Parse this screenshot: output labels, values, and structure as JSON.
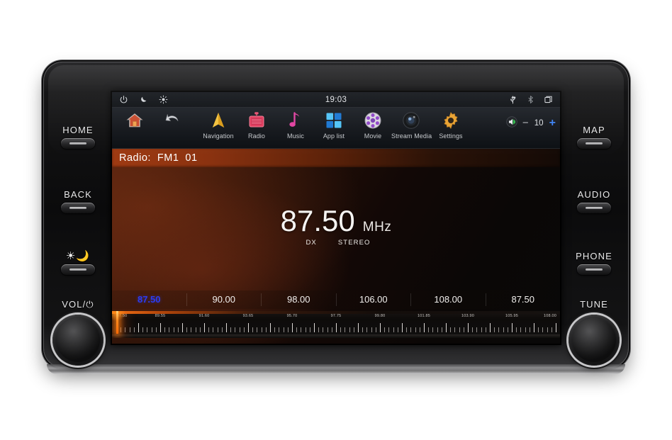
{
  "device": {
    "left_buttons": [
      {
        "label": "HOME",
        "name": "home-button"
      },
      {
        "label": "BACK",
        "name": "back-button"
      },
      {
        "label": "",
        "name": "brightness-daynight-button"
      }
    ],
    "left_knob_label": "VOL/⏻",
    "right_buttons": [
      {
        "label": "MAP",
        "name": "map-button"
      },
      {
        "label": "AUDIO",
        "name": "audio-button"
      },
      {
        "label": "PHONE",
        "name": "phone-button"
      }
    ],
    "right_knob_label": "TUNE"
  },
  "status_bar": {
    "clock": "19:03",
    "left_icons": [
      "power-icon",
      "night-mode-icon",
      "brightness-icon"
    ],
    "right_icons": [
      "usb-icon",
      "bluetooth-icon",
      "multitask-icon"
    ]
  },
  "app_bar": {
    "items": [
      {
        "label": "",
        "icon": "home-icon"
      },
      {
        "label": "",
        "icon": "back-arrow-icon"
      },
      {
        "label": "Navigation",
        "icon": "navigation-icon"
      },
      {
        "label": "Radio",
        "icon": "radio-icon"
      },
      {
        "label": "Music",
        "icon": "music-note-icon"
      },
      {
        "label": "App list",
        "icon": "app-grid-icon"
      },
      {
        "label": "Movie",
        "icon": "movie-disc-icon"
      },
      {
        "label": "Stream Media",
        "icon": "camera-lens-icon"
      },
      {
        "label": "Settings",
        "icon": "gear-icon"
      }
    ],
    "volume": {
      "icon": "speaker-icon",
      "minus": "−",
      "value": "10",
      "plus": "+"
    }
  },
  "radio": {
    "title_prefix": "Radio:",
    "band": "FM1",
    "preset_number": "01",
    "frequency": "87.50",
    "unit": "MHz",
    "tags": [
      "DX",
      "STEREO"
    ],
    "presets": [
      {
        "value": "87.50",
        "active": true
      },
      {
        "value": "90.00",
        "active": false
      },
      {
        "value": "98.00",
        "active": false
      },
      {
        "value": "106.00",
        "active": false
      },
      {
        "value": "108.00",
        "active": false
      },
      {
        "value": "87.50",
        "active": false
      }
    ],
    "tuner": {
      "min": 87.5,
      "max": 108.0,
      "current": 87.5,
      "labels": [
        "87.50",
        "89.55",
        "91.60",
        "93.65",
        "95.70",
        "97.75",
        "99.80",
        "101.85",
        "103.90",
        "105.95",
        "108.00"
      ]
    }
  },
  "toolbar": {
    "items": [
      {
        "icon": "collapse-arrows-icon",
        "name": "collapse-button"
      },
      {
        "icon": "signal-waves-icon",
        "name": "signal-button"
      },
      {
        "icon": "keyboard-icon",
        "name": "preset-list-button"
      },
      {
        "icon": "search-icon",
        "name": "scan-search-button"
      },
      {
        "icon": "previous-track-icon",
        "name": "previous-button"
      },
      {
        "icon": "next-track-icon",
        "name": "next-button"
      },
      {
        "icon": "equalizer-icon",
        "name": "equalizer-button"
      },
      {
        "icon": "more-dots-icon",
        "name": "more-button"
      }
    ]
  },
  "colors": {
    "accent_blue": "#2b3cf0",
    "plus_blue": "#3b82f6",
    "title_orange": "#9e3a12",
    "needle_orange": "#ff8a1e"
  }
}
